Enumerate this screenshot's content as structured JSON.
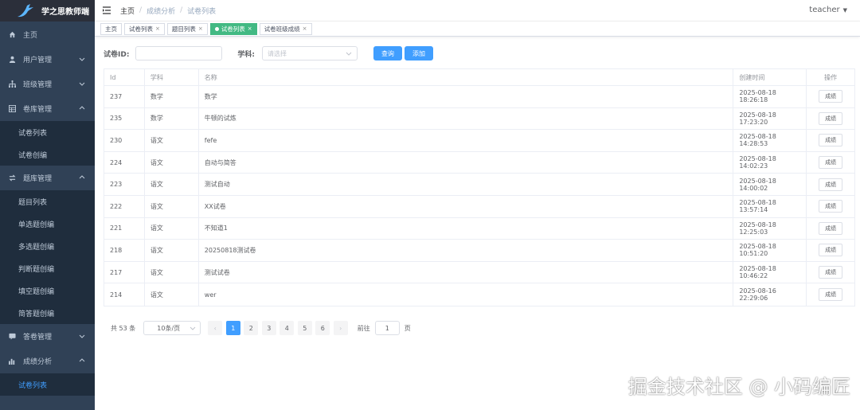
{
  "sidebar": {
    "logo_text": "学之思教师端",
    "items": [
      {
        "label": "主页",
        "icon": "home-icon"
      },
      {
        "label": "用户管理",
        "icon": "user-icon"
      },
      {
        "label": "班级管理",
        "icon": "org-icon"
      },
      {
        "label": "卷库管理",
        "icon": "table-icon"
      },
      {
        "label": "试卷列表",
        "sub": true
      },
      {
        "label": "试卷创编",
        "sub": true
      },
      {
        "label": "题库管理",
        "icon": "sort-icon"
      },
      {
        "label": "题目列表",
        "sub": true
      },
      {
        "label": "单选题创编",
        "sub": true
      },
      {
        "label": "多选题创编",
        "sub": true
      },
      {
        "label": "判断题创编",
        "sub": true
      },
      {
        "label": "填空题创编",
        "sub": true
      },
      {
        "label": "简答题创编",
        "sub": true
      },
      {
        "label": "答卷管理",
        "icon": "message-icon"
      },
      {
        "label": "成绩分析",
        "icon": "chart-icon"
      },
      {
        "label": "试卷列表",
        "sub": true,
        "active": true
      }
    ]
  },
  "topbar": {
    "breadcrumb": [
      "主页",
      "成绩分析",
      "试卷列表"
    ],
    "user": "teacher"
  },
  "tags": [
    {
      "label": "主页",
      "closable": false
    },
    {
      "label": "试卷列表",
      "closable": true
    },
    {
      "label": "题目列表",
      "closable": true
    },
    {
      "label": "试卷列表",
      "closable": true,
      "active": true
    },
    {
      "label": "试卷班级成绩",
      "closable": true
    }
  ],
  "search": {
    "id_label": "试卷ID:",
    "subject_label": "学科:",
    "subject_placeholder": "请选择",
    "query_button": "查询",
    "add_button": "添加"
  },
  "table": {
    "headers": [
      "Id",
      "学科",
      "名称",
      "创建时间",
      "操作"
    ],
    "rows": [
      {
        "id": "237",
        "subject": "数学",
        "name": "数学",
        "time": "2025-08-18 18:26:18",
        "action": "成绩"
      },
      {
        "id": "235",
        "subject": "数学",
        "name": "牛顿的试炼",
        "time": "2025-08-18 17:23:20",
        "action": "成绩"
      },
      {
        "id": "230",
        "subject": "语文",
        "name": "fefe",
        "time": "2025-08-18 14:28:53",
        "action": "成绩"
      },
      {
        "id": "224",
        "subject": "语文",
        "name": "自动与简答",
        "time": "2025-08-18 14:02:23",
        "action": "成绩"
      },
      {
        "id": "223",
        "subject": "语文",
        "name": "测试自动",
        "time": "2025-08-18 14:00:02",
        "action": "成绩"
      },
      {
        "id": "222",
        "subject": "语文",
        "name": "XX试卷",
        "time": "2025-08-18 13:57:14",
        "action": "成绩"
      },
      {
        "id": "221",
        "subject": "语文",
        "name": "不知道1",
        "time": "2025-08-18 12:25:03",
        "action": "成绩"
      },
      {
        "id": "218",
        "subject": "语文",
        "name": "20250818测试卷",
        "time": "2025-08-18 10:51:20",
        "action": "成绩"
      },
      {
        "id": "217",
        "subject": "语文",
        "name": "测试试卷",
        "time": "2025-08-18 10:46:22",
        "action": "成绩"
      },
      {
        "id": "214",
        "subject": "语文",
        "name": "wer",
        "time": "2025-08-16 22:29:06",
        "action": "成绩"
      }
    ]
  },
  "pager": {
    "total": "共 53 条",
    "page_size": "10条/页",
    "pages": [
      "1",
      "2",
      "3",
      "4",
      "5",
      "6"
    ],
    "current": "1",
    "goto_label": "前往",
    "goto_value": "1",
    "page_suffix": "页"
  },
  "watermark": "掘金技术社区 @ 小码编匠",
  "colors": {
    "sidebar_bg": "#304156",
    "primary": "#409eff",
    "tag_active": "#42b983"
  }
}
